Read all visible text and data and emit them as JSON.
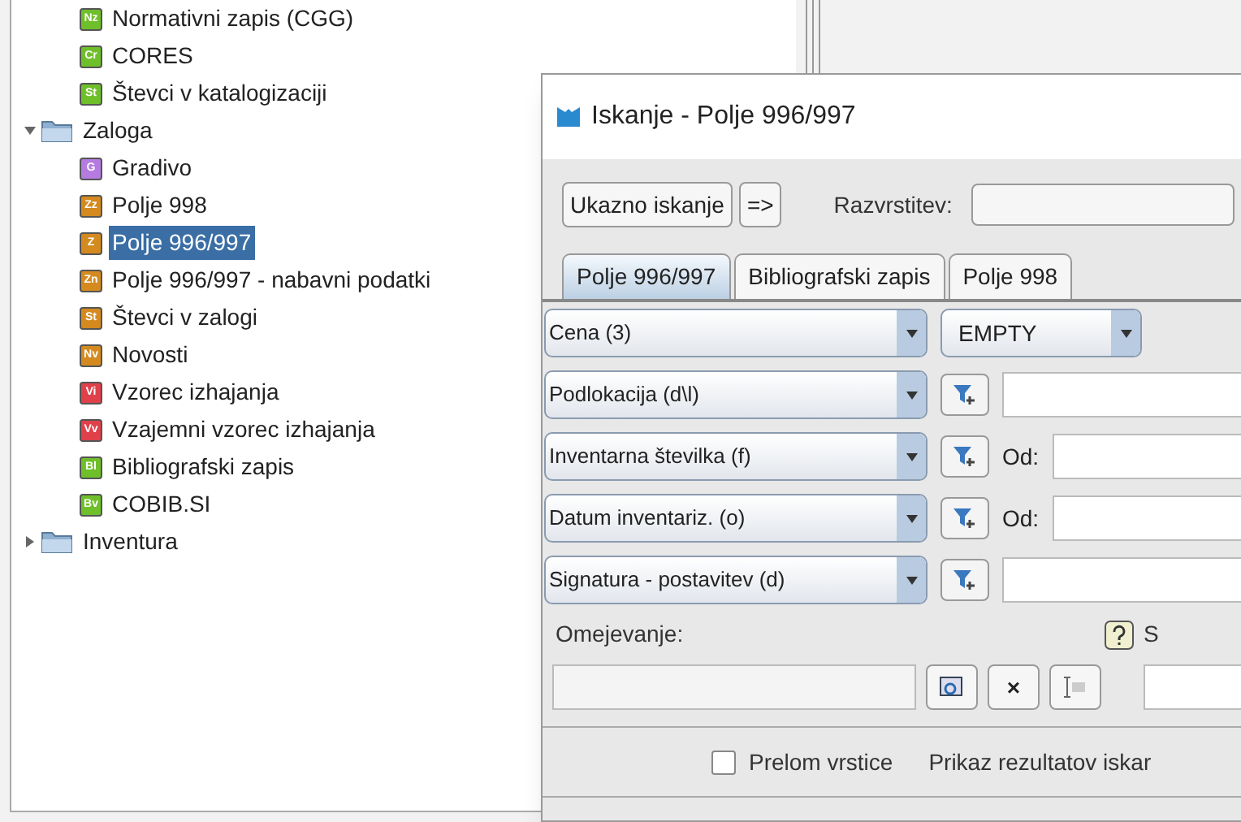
{
  "tree": [
    {
      "label": "Normativni zapis (CGG)",
      "badge": "Nz",
      "color": "#6fbf2a",
      "kind": "leaf",
      "selected": false
    },
    {
      "label": "CORES",
      "badge": "Cr",
      "color": "#6fbf2a",
      "kind": "leaf",
      "selected": false
    },
    {
      "label": "Števci v katalogizaciji",
      "badge": "St",
      "color": "#6fbf2a",
      "kind": "leaf",
      "selected": false
    },
    {
      "label": "Zaloga",
      "kind": "folder",
      "expanded": true,
      "selected": false,
      "children": [
        {
          "label": "Gradivo",
          "badge": "G",
          "color": "#b57be0",
          "kind": "leaf",
          "selected": false
        },
        {
          "label": "Polje 998",
          "badge": "Zz",
          "color": "#d48a1e",
          "kind": "leaf",
          "selected": false
        },
        {
          "label": "Polje 996/997",
          "badge": "Z",
          "color": "#d48a1e",
          "kind": "leaf",
          "selected": true
        },
        {
          "label": "Polje 996/997 - nabavni podatki",
          "badge": "Zn",
          "color": "#d48a1e",
          "kind": "leaf",
          "selected": false
        },
        {
          "label": "Števci v zalogi",
          "badge": "St",
          "color": "#d48a1e",
          "kind": "leaf",
          "selected": false
        },
        {
          "label": "Novosti",
          "badge": "Nv",
          "color": "#d48a1e",
          "kind": "leaf",
          "selected": false
        },
        {
          "label": "Vzorec izhajanja",
          "badge": "Vi",
          "color": "#e0404a",
          "kind": "leaf",
          "selected": false
        },
        {
          "label": "Vzajemni vzorec izhajanja",
          "badge": "Vv",
          "color": "#e0404a",
          "kind": "leaf",
          "selected": false
        },
        {
          "label": "Bibliografski zapis",
          "badge": "Bl",
          "color": "#6fbf2a",
          "kind": "leaf",
          "selected": false
        },
        {
          "label": "COBIB.SI",
          "badge": "Bv",
          "color": "#6fbf2a",
          "kind": "leaf",
          "selected": false
        }
      ]
    },
    {
      "label": "Inventura",
      "kind": "folder",
      "expanded": false,
      "selected": false
    }
  ],
  "dialog": {
    "title": "Iskanje - Polje 996/997",
    "buttons": [
      "Ukazno iskanje",
      "=>"
    ],
    "sort_label": "Razvrstitev:",
    "tabs": [
      {
        "label": "Polje 996/997",
        "selected": true
      },
      {
        "label": "Bibliografski zapis",
        "selected": false
      },
      {
        "label": "Polje 998",
        "selected": false
      }
    ],
    "rows": [
      {
        "field": "Cena (3)",
        "kind": "select",
        "value": "EMPTY"
      },
      {
        "field": "Podlokacija (d\\l)",
        "kind": "filter"
      },
      {
        "field": "Inventarna številka (f)",
        "kind": "range",
        "from_label": "Od:"
      },
      {
        "field": "Datum inventariz. (o)",
        "kind": "range",
        "from_label": "Od:"
      },
      {
        "field": "Signatura - postavitev (d)",
        "kind": "filter"
      }
    ],
    "limit_label": "Omejevanje:",
    "help_label": "S",
    "clear_symbol": "×",
    "wrap": {
      "label": "Prelom vrstice",
      "checked": false
    },
    "results_label": "Prikaz rezultatov iskar"
  }
}
